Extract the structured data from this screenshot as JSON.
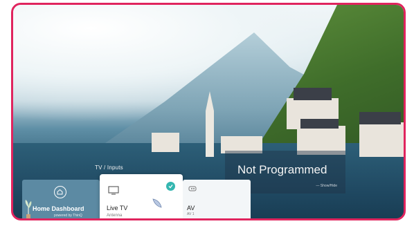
{
  "section_label": "TV / Inputs",
  "info_panel": {
    "title": "Not Programmed",
    "subtitle": "— Show/Hide"
  },
  "cards": {
    "home": {
      "label": "Home Dashboard",
      "sublabel": "powered by ThinQ",
      "icon": "home-icon"
    },
    "live_tv": {
      "label": "Live TV",
      "sublabel": "Antenna",
      "icon": "tv-icon",
      "selected": true
    },
    "av": {
      "label": "AV",
      "sublabel": "AV 1",
      "icon": "av-input-icon"
    }
  },
  "colors": {
    "frame_border": "#e0245e",
    "check_badge": "#34b6b0",
    "home_card": "#5c8aa3"
  }
}
